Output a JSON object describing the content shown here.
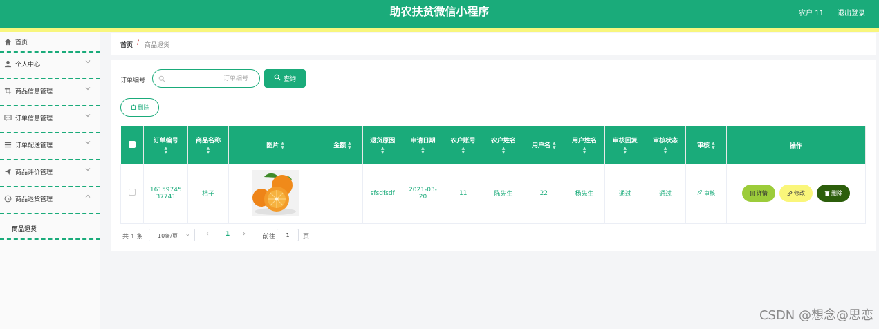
{
  "header": {
    "title": "助农扶贫微信小程序",
    "user": "农户 11",
    "logout": "退出登录",
    "brand_color": "#1aab7a",
    "stripe_color": "#f8f67d"
  },
  "sidebar": {
    "items": [
      {
        "label": "首页",
        "icon": "home-icon"
      },
      {
        "label": "个人中心",
        "icon": "user-icon"
      },
      {
        "label": "商品信息管理",
        "icon": "crop-icon"
      },
      {
        "label": "订单信息管理",
        "icon": "message-icon"
      },
      {
        "label": "订单配送管理",
        "icon": "list-icon"
      },
      {
        "label": "商品评价管理",
        "icon": "send-icon"
      },
      {
        "label": "商品退货管理",
        "icon": "clock-icon"
      }
    ],
    "sub_item": "商品退货"
  },
  "breadcrumb": {
    "home": "首页",
    "separator": "/",
    "current": "商品退货"
  },
  "search": {
    "label": "订单编号",
    "placeholder": "订单编号",
    "query_button": "查询",
    "delete_button": "删除"
  },
  "table": {
    "columns": [
      "订单编号",
      "商品名称",
      "图片",
      "金额",
      "退货原因",
      "申请日期",
      "农户账号",
      "农户姓名",
      "用户名",
      "用户姓名",
      "审核回复",
      "审核状态",
      "审核",
      "操作"
    ],
    "rows": [
      {
        "order_no": "16159745 37741",
        "product_name": "桔子",
        "image": "orange-photo",
        "amount": "",
        "reason": "sfsdfsdf",
        "apply_date": "2021-03-20",
        "farmer_account": "11",
        "farmer_name": "陈先生",
        "username": "22",
        "user_name": "杨先生",
        "audit_reply": "通过",
        "audit_status": "通过",
        "audit_link": "审核",
        "actions": {
          "detail": "详情",
          "edit": "修改",
          "delete": "删除"
        }
      }
    ],
    "action_colors": {
      "detail": "#9ccc3a",
      "edit": "#faf67a",
      "delete": "#2c5e0b"
    }
  },
  "pagination": {
    "total": "共 1 条",
    "page_size": "10条/页",
    "current_page": "1",
    "goto_label": "前往",
    "goto_value": "1",
    "page_suffix": "页"
  },
  "watermark": "CSDN @想念@思恋"
}
